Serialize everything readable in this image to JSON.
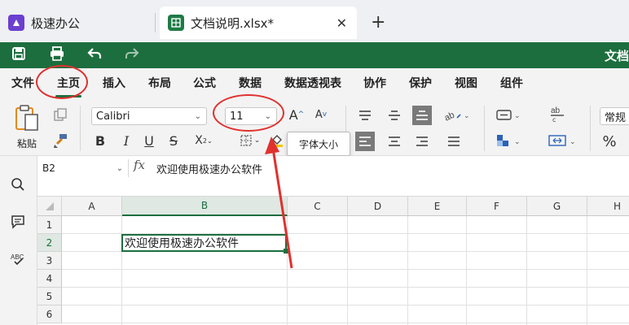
{
  "tabs": [
    {
      "label": "极速办公"
    },
    {
      "label": "文档说明.xlsx*"
    }
  ],
  "tab_add": "+",
  "titlebar": {
    "truncated_title": "文档"
  },
  "menu": [
    "文件",
    "主页",
    "插入",
    "布局",
    "公式",
    "数据",
    "数据透视表",
    "协作",
    "保护",
    "视图",
    "组件"
  ],
  "active_menu": "主页",
  "ribbon": {
    "paste_label": "粘贴",
    "font_name": "Calibri",
    "font_size": "11",
    "number_format": "常规",
    "tooltip": "字体大小",
    "bold": "B",
    "italic": "I",
    "underline": "U",
    "strike": "S",
    "percent": "%"
  },
  "formula_bar": {
    "name_box": "B2",
    "fx": "fx",
    "value": "欢迎使用极速办公软件"
  },
  "grid": {
    "columns": [
      "A",
      "B",
      "C",
      "D",
      "E",
      "F",
      "G",
      "H"
    ],
    "rows": [
      "1",
      "2",
      "3",
      "4",
      "5",
      "6"
    ],
    "selected_cell": "B2",
    "b2_value": "欢迎使用极速办公软件"
  },
  "colors": {
    "accent": "#1c6e3e",
    "annotation": "#e0312f",
    "app_icon": "#6b3fd0"
  }
}
